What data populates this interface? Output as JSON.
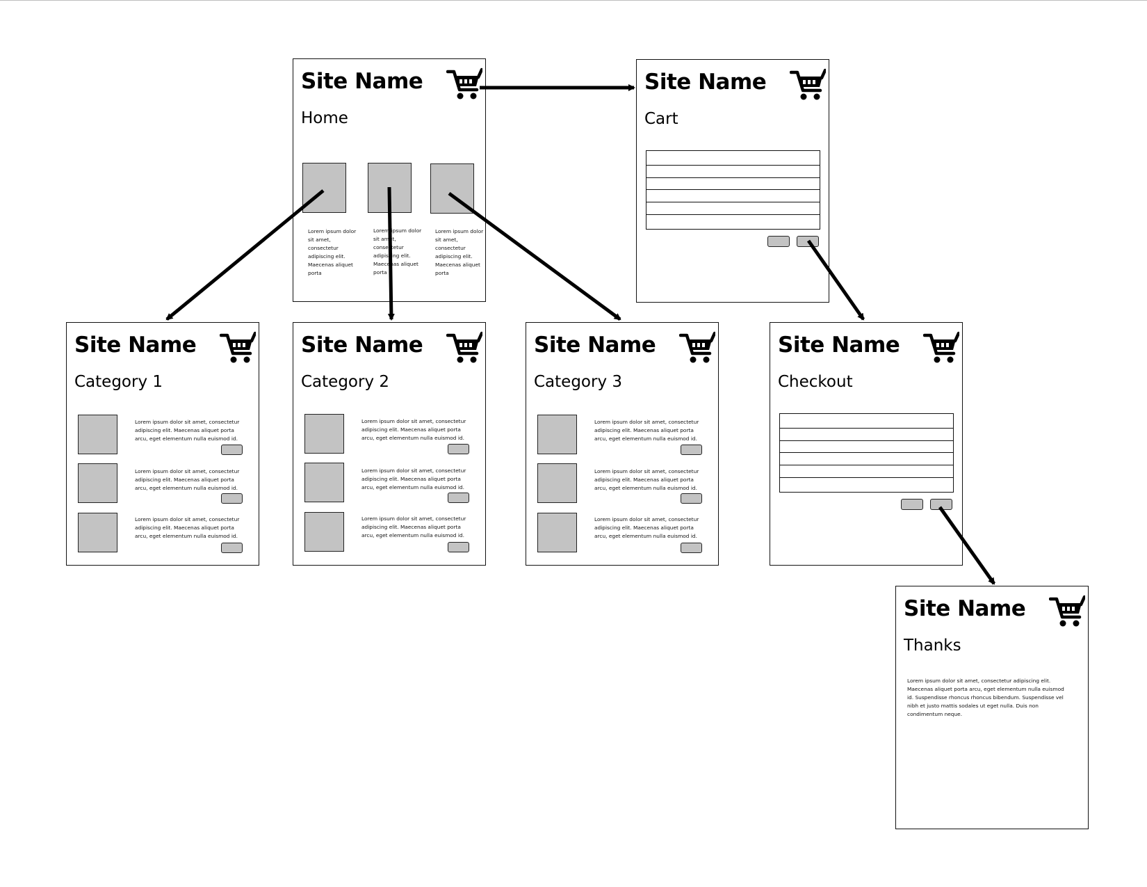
{
  "site_name": "Site Name",
  "pages": {
    "home": {
      "title": "Home",
      "item_texts": [
        "Lorem ipsum dolor sit amet, consectetur adipiscing elit. Maecenas aliquet porta",
        "Lorem ipsum dolor sit amet, consectetur adipiscing elit. Maecenas aliquet porta",
        "Lorem ipsum dolor sit amet, consectetur adipiscing elit. Maecenas aliquet porta"
      ]
    },
    "cart": {
      "title": "Cart"
    },
    "category1": {
      "title": "Category 1"
    },
    "category2": {
      "title": "Category 2"
    },
    "category3": {
      "title": "Category 3"
    },
    "checkout": {
      "title": "Checkout"
    },
    "thanks": {
      "title": "Thanks",
      "text": "Lorem ipsum dolor sit amet, consectetur adipiscing elit. Maecenas aliquet porta arcu, eget elementum nulla euismod id. Suspendisse rhoncus rhoncus bibendum. Suspendisse vel nibh et justo mattis sodales ut eget nulla. Duis non condimentum neque."
    }
  },
  "category_item_text": "Lorem ipsum dolor sit amet, consectetur adipiscing elit. Maecenas aliquet porta arcu, eget elementum nulla euismod id.",
  "icons": {
    "cart": "shopping-cart-icon"
  },
  "colors": {
    "placeholder": "#c3c3c3",
    "stroke": "#111111"
  }
}
